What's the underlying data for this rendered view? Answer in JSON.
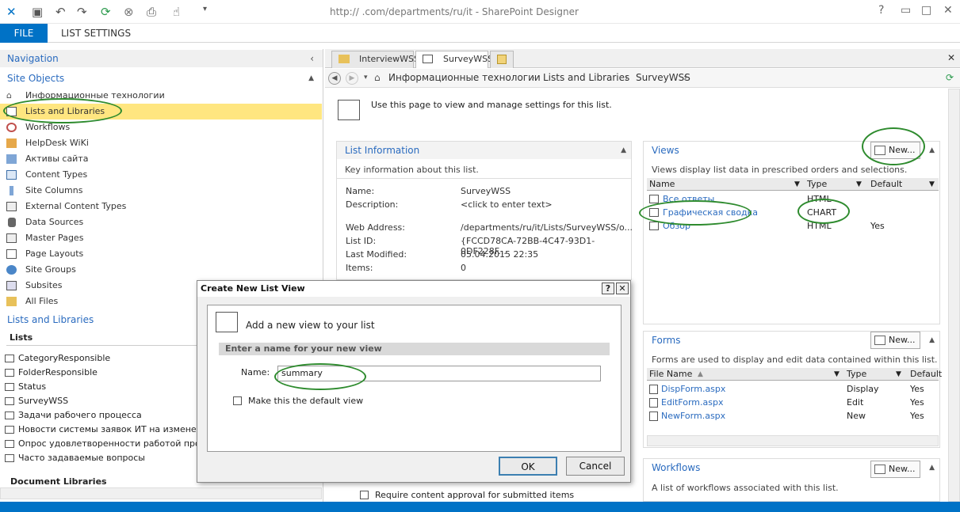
{
  "window": {
    "title": "http://                    .com/departments/ru/it - SharePoint Designer"
  },
  "ribbon": {
    "file": "FILE",
    "list_settings": "LIST SETTINGS"
  },
  "nav": {
    "header": "Navigation",
    "site_objects": "Site Objects",
    "items": [
      {
        "label": "Информационные технологии",
        "icon": "site-icon"
      },
      {
        "label": "Lists and Libraries",
        "icon": "list-icon",
        "selected": true
      },
      {
        "label": "Workflows",
        "icon": "workflow-icon"
      },
      {
        "label": "HelpDesk WiKi",
        "icon": "wiki-icon"
      },
      {
        "label": "Активы сайта",
        "icon": "assets-icon"
      },
      {
        "label": "Content Types",
        "icon": "content-type-icon"
      },
      {
        "label": "Site Columns",
        "icon": "column-icon"
      },
      {
        "label": "External Content Types",
        "icon": "external-icon"
      },
      {
        "label": "Data Sources",
        "icon": "database-icon"
      },
      {
        "label": "Master Pages",
        "icon": "master-page-icon"
      },
      {
        "label": "Page Layouts",
        "icon": "page-layout-icon"
      },
      {
        "label": "Site Groups",
        "icon": "group-icon"
      },
      {
        "label": "Subsites",
        "icon": "subsite-icon"
      },
      {
        "label": "All Files",
        "icon": "folder-icon"
      }
    ],
    "lists_header": "Lists and Libraries",
    "lists_title": "Lists",
    "lists": [
      "CategoryResponsible",
      "FolderResponsible",
      "Status",
      "SurveyWSS",
      "Задачи рабочего процесса",
      "Новости системы заявок ИТ на изменение",
      "Опрос удовлетворенности работой программ",
      "Часто задаваемые вопросы"
    ],
    "doc_libraries": "Document Libraries"
  },
  "tabs": [
    {
      "label": "InterviewWSS"
    },
    {
      "label": "SurveyWSS"
    }
  ],
  "breadcrumb": {
    "site": "Информационные технологии",
    "lists": "Lists and Libraries",
    "current": "SurveyWSS"
  },
  "intro": "Use this page to view and manage settings for this list.",
  "list_info": {
    "title": "List Information",
    "desc": "Key information about this list.",
    "name_label": "Name:",
    "name_value": "SurveyWSS",
    "desc_label": "Description:",
    "desc_value": "<click to enter text>",
    "web_label": "Web Address:",
    "web_value": "/departments/ru/it/Lists/SurveyWSS/o...",
    "id_label": "List ID:",
    "id_value": "{FCCD78CA-72BB-4C47-93D1-0DF228F...",
    "mod_label": "Last Modified:",
    "mod_value": "05.04.2015 22:35",
    "items_label": "Items:",
    "items_value": "0"
  },
  "views": {
    "title": "Views",
    "new": "New...",
    "desc": "Views display list data in prescribed orders and selections.",
    "cols": [
      "Name",
      "Type",
      "Default"
    ],
    "rows": [
      {
        "name": "Все ответы",
        "type": "HTML",
        "default": ""
      },
      {
        "name": "Графическая сводка",
        "type": "CHART",
        "default": ""
      },
      {
        "name": "Обзор",
        "type": "HTML",
        "default": "Yes"
      }
    ]
  },
  "forms": {
    "title": "Forms",
    "new": "New...",
    "desc": "Forms are used to display and edit data contained within this list.",
    "cols": [
      "File Name",
      "Type",
      "Default"
    ],
    "rows": [
      {
        "name": "DispForm.aspx",
        "type": "Display",
        "default": "Yes"
      },
      {
        "name": "EditForm.aspx",
        "type": "Edit",
        "default": "Yes"
      },
      {
        "name": "NewForm.aspx",
        "type": "New",
        "default": "Yes"
      }
    ]
  },
  "workflows": {
    "title": "Workflows",
    "new": "New...",
    "desc": "A list of workflows associated with this list."
  },
  "settings": {
    "approval": "Require content approval for submitted items"
  },
  "dialog": {
    "title": "Create New List View",
    "help": "?",
    "close": "✕",
    "heading": "Add a new view to your list",
    "section": "Enter a name for your new view",
    "name_label": "Name:",
    "name_value": "summary",
    "default_label": "Make this the default view",
    "ok": "OK",
    "cancel": "Cancel"
  }
}
